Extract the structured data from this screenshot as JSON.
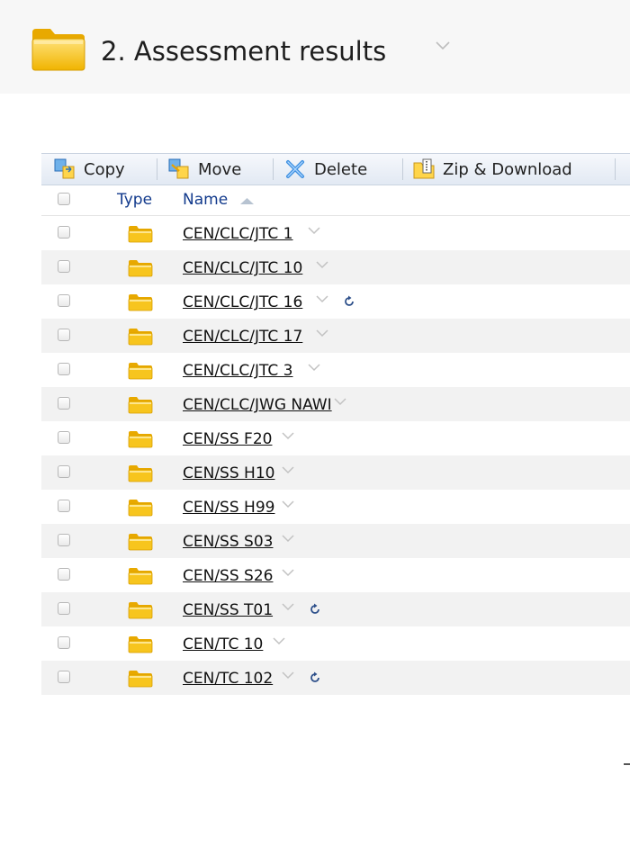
{
  "folder": {
    "title": "2. Assessment results",
    "icon": "folder-icon",
    "color": "#f5c518"
  },
  "toolbar": {
    "copy_label": "Copy",
    "move_label": "Move",
    "delete_label": "Delete",
    "zip_label": "Zip & Download"
  },
  "table": {
    "col_type": "Type",
    "col_name": "Name",
    "sort": "ascending",
    "rows": [
      {
        "name": "CEN/CLC/JTC 1",
        "sync": false
      },
      {
        "name": "CEN/CLC/JTC 10",
        "sync": false
      },
      {
        "name": "CEN/CLC/JTC 16",
        "sync": true
      },
      {
        "name": "CEN/CLC/JTC 17",
        "sync": false
      },
      {
        "name": "CEN/CLC/JTC 3",
        "sync": false
      },
      {
        "name": "CEN/CLC/JWG NAWI",
        "sync": false
      },
      {
        "name": "CEN/SS F20",
        "sync": false
      },
      {
        "name": "CEN/SS H10",
        "sync": false
      },
      {
        "name": "CEN/SS H99",
        "sync": false
      },
      {
        "name": "CEN/SS S03",
        "sync": false
      },
      {
        "name": "CEN/SS S26",
        "sync": false
      },
      {
        "name": "CEN/SS T01",
        "sync": true
      },
      {
        "name": "CEN/TC 10",
        "sync": false
      },
      {
        "name": "CEN/TC 102",
        "sync": true
      }
    ]
  }
}
